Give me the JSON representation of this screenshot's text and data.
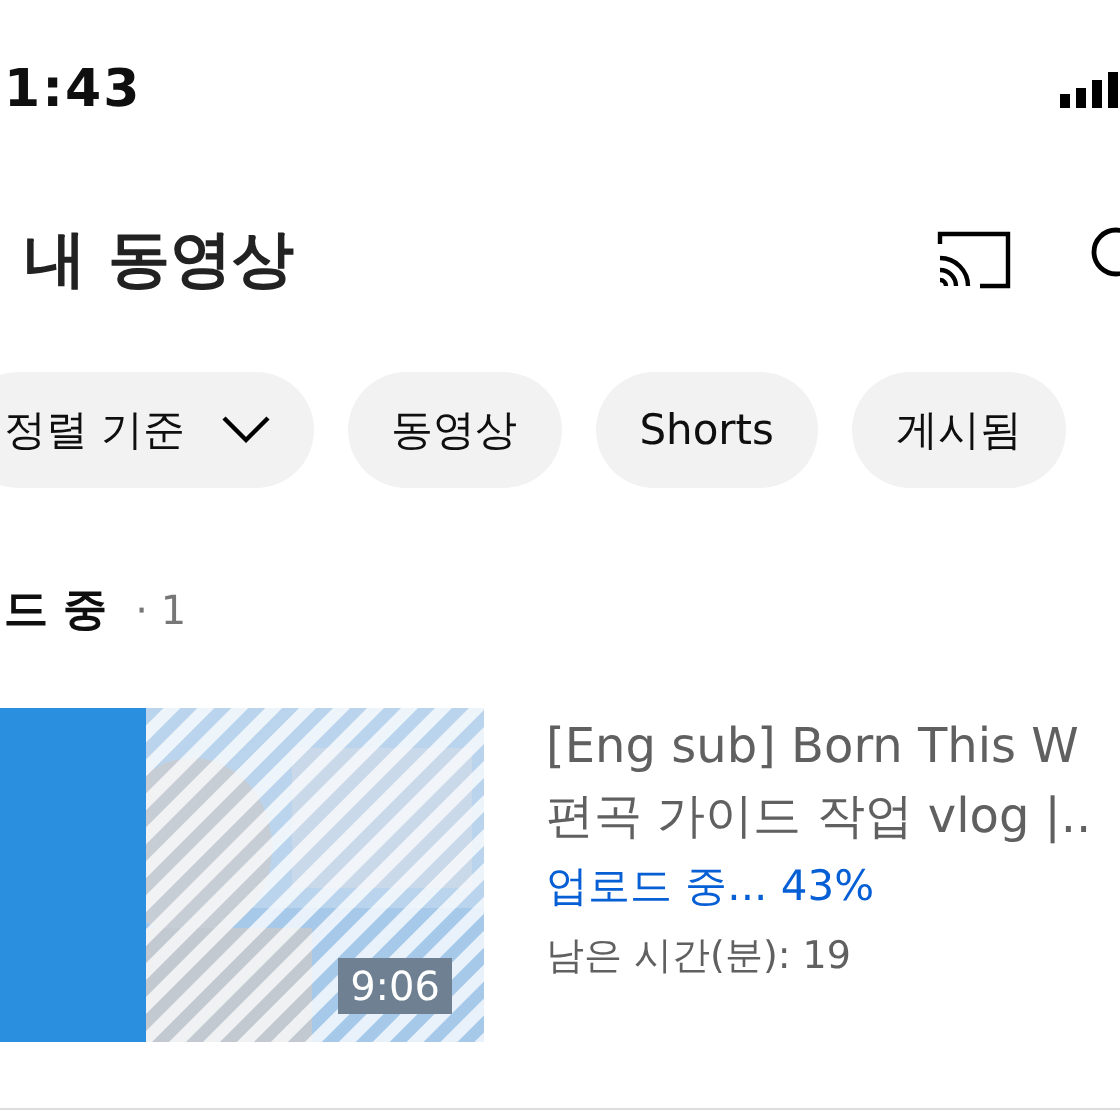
{
  "status_bar": {
    "time": "1:43"
  },
  "header": {
    "title": "내 동영상"
  },
  "filters": [
    {
      "kind": "dropdown",
      "label": "정렬 기준"
    },
    {
      "kind": "chip",
      "label": "동영상"
    },
    {
      "kind": "chip",
      "label": "Shorts"
    },
    {
      "kind": "chip",
      "label": "게시됨"
    }
  ],
  "section": {
    "title": "드 중",
    "count": "· 1"
  },
  "uploads": [
    {
      "title_lines": [
        "[Eng sub] Born This W",
        "편곡 가이드 작업 vlog |.."
      ],
      "status": "업로드 중... 43%",
      "remaining": "남은 시간(분): 19",
      "duration": "9:06"
    }
  ]
}
